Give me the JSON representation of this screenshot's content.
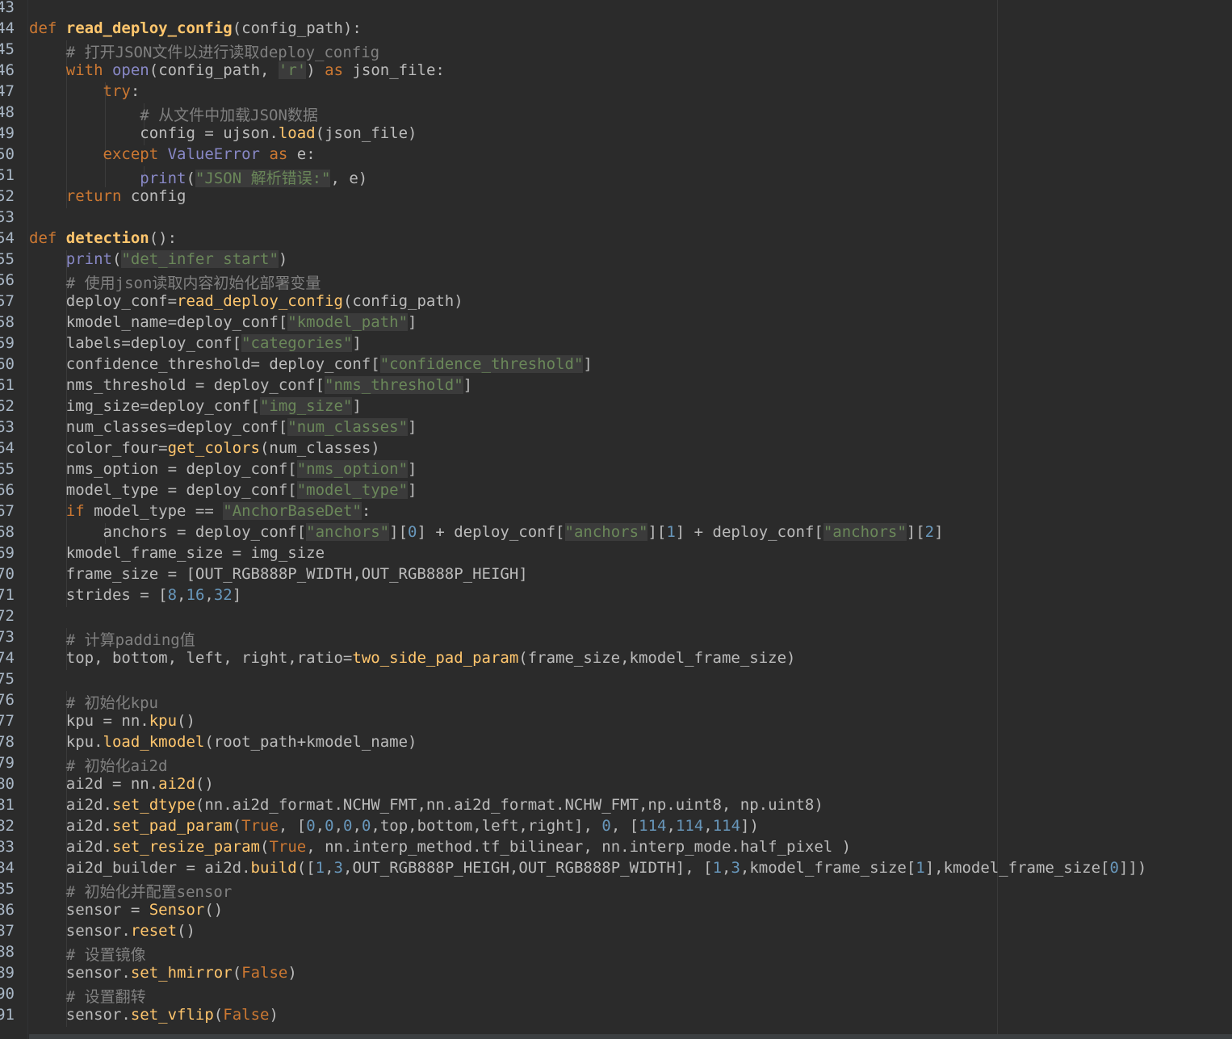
{
  "editor": {
    "language": "python",
    "first_line": 43,
    "lines": [
      {
        "n": "43",
        "indent": 0,
        "text": ""
      },
      {
        "n": "44",
        "indent": 0,
        "text": "def read_deploy_config(config_path):"
      },
      {
        "n": "45",
        "indent": 1,
        "text": "    # 打开JSON文件以进行读取deploy_config"
      },
      {
        "n": "46",
        "indent": 1,
        "text": "    with open(config_path, 'r') as json_file:"
      },
      {
        "n": "47",
        "indent": 2,
        "text": "        try:"
      },
      {
        "n": "48",
        "indent": 3,
        "text": "            # 从文件中加载JSON数据"
      },
      {
        "n": "49",
        "indent": 3,
        "text": "            config = ujson.load(json_file)"
      },
      {
        "n": "50",
        "indent": 2,
        "text": "        except ValueError as e:"
      },
      {
        "n": "51",
        "indent": 3,
        "text": "            print(\"JSON 解析错误:\", e)"
      },
      {
        "n": "52",
        "indent": 1,
        "text": "    return config"
      },
      {
        "n": "53",
        "indent": 0,
        "text": ""
      },
      {
        "n": "54",
        "indent": 0,
        "text": "def detection():"
      },
      {
        "n": "55",
        "indent": 1,
        "text": "    print(\"det_infer start\")"
      },
      {
        "n": "56",
        "indent": 1,
        "text": "    # 使用json读取内容初始化部署变量"
      },
      {
        "n": "57",
        "indent": 1,
        "text": "    deploy_conf=read_deploy_config(config_path)"
      },
      {
        "n": "58",
        "indent": 1,
        "text": "    kmodel_name=deploy_conf[\"kmodel_path\"]"
      },
      {
        "n": "59",
        "indent": 1,
        "text": "    labels=deploy_conf[\"categories\"]"
      },
      {
        "n": "60",
        "indent": 1,
        "text": "    confidence_threshold= deploy_conf[\"confidence_threshold\"]"
      },
      {
        "n": "61",
        "indent": 1,
        "text": "    nms_threshold = deploy_conf[\"nms_threshold\"]"
      },
      {
        "n": "62",
        "indent": 1,
        "text": "    img_size=deploy_conf[\"img_size\"]"
      },
      {
        "n": "63",
        "indent": 1,
        "text": "    num_classes=deploy_conf[\"num_classes\"]"
      },
      {
        "n": "64",
        "indent": 1,
        "text": "    color_four=get_colors(num_classes)"
      },
      {
        "n": "65",
        "indent": 1,
        "text": "    nms_option = deploy_conf[\"nms_option\"]"
      },
      {
        "n": "66",
        "indent": 1,
        "text": "    model_type = deploy_conf[\"model_type\"]"
      },
      {
        "n": "67",
        "indent": 1,
        "text": "    if model_type == \"AnchorBaseDet\":"
      },
      {
        "n": "68",
        "indent": 2,
        "text": "        anchors = deploy_conf[\"anchors\"][0] + deploy_conf[\"anchors\"][1] + deploy_conf[\"anchors\"][2]"
      },
      {
        "n": "69",
        "indent": 1,
        "text": "    kmodel_frame_size = img_size"
      },
      {
        "n": "70",
        "indent": 1,
        "text": "    frame_size = [OUT_RGB888P_WIDTH,OUT_RGB888P_HEIGH]"
      },
      {
        "n": "71",
        "indent": 1,
        "text": "    strides = [8,16,32]"
      },
      {
        "n": "72",
        "indent": 0,
        "text": ""
      },
      {
        "n": "73",
        "indent": 1,
        "text": "    # 计算padding值"
      },
      {
        "n": "74",
        "indent": 1,
        "text": "    top, bottom, left, right,ratio=two_side_pad_param(frame_size,kmodel_frame_size)"
      },
      {
        "n": "75",
        "indent": 0,
        "text": ""
      },
      {
        "n": "76",
        "indent": 1,
        "text": "    # 初始化kpu"
      },
      {
        "n": "77",
        "indent": 1,
        "text": "    kpu = nn.kpu()"
      },
      {
        "n": "78",
        "indent": 1,
        "text": "    kpu.load_kmodel(root_path+kmodel_name)"
      },
      {
        "n": "79",
        "indent": 1,
        "text": "    # 初始化ai2d"
      },
      {
        "n": "80",
        "indent": 1,
        "text": "    ai2d = nn.ai2d()"
      },
      {
        "n": "81",
        "indent": 1,
        "text": "    ai2d.set_dtype(nn.ai2d_format.NCHW_FMT,nn.ai2d_format.NCHW_FMT,np.uint8, np.uint8)"
      },
      {
        "n": "82",
        "indent": 1,
        "text": "    ai2d.set_pad_param(True, [0,0,0,0,top,bottom,left,right], 0, [114,114,114])"
      },
      {
        "n": "83",
        "indent": 1,
        "text": "    ai2d.set_resize_param(True, nn.interp_method.tf_bilinear, nn.interp_mode.half_pixel )"
      },
      {
        "n": "84",
        "indent": 1,
        "text": "    ai2d_builder = ai2d.build([1,3,OUT_RGB888P_HEIGH,OUT_RGB888P_WIDTH], [1,3,kmodel_frame_size[1],kmodel_frame_size[0]])"
      },
      {
        "n": "85",
        "indent": 1,
        "text": "    # 初始化并配置sensor"
      },
      {
        "n": "86",
        "indent": 1,
        "text": "    sensor = Sensor()"
      },
      {
        "n": "87",
        "indent": 1,
        "text": "    sensor.reset()"
      },
      {
        "n": "88",
        "indent": 1,
        "text": "    # 设置镜像"
      },
      {
        "n": "89",
        "indent": 1,
        "text": "    sensor.set_hmirror(False)"
      },
      {
        "n": "90",
        "indent": 1,
        "text": "    # 设置翻转"
      },
      {
        "n": "91",
        "indent": 1,
        "text": "    sensor.set_vflip(False)"
      }
    ]
  },
  "colors": {
    "background": "#2b2b2b",
    "keyword": "#cc7832",
    "function": "#ffc66d",
    "string": "#6a8759",
    "comment": "#808080",
    "number": "#6897bb"
  }
}
